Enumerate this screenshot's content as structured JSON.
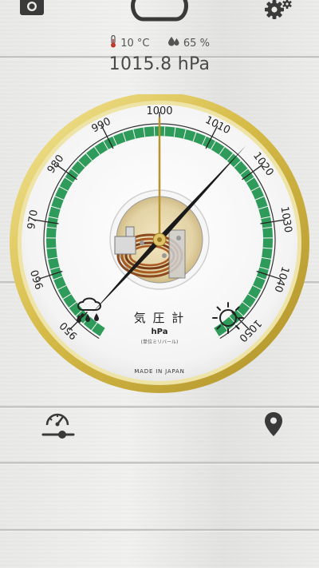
{
  "weather": {
    "temperature": "10 °C",
    "humidity": "65 %",
    "pressure_reading": "1015.8 hPa"
  },
  "gauge": {
    "scale": [
      950,
      960,
      970,
      980,
      990,
      1000,
      1010,
      1020,
      1030,
      1040,
      1050
    ],
    "scale_labels": [
      "950",
      "960",
      "970",
      "980",
      "990",
      "1000",
      "1010",
      "1020",
      "1030",
      "1040",
      "1050"
    ],
    "min": 945,
    "max": 1055,
    "needle_value": 1015.8,
    "reference_value": 1000,
    "title": "気 圧 計",
    "unit": "hPa",
    "subtitle": "(単位ミリバール)",
    "maker": "MADE IN JAPAN",
    "colors": {
      "band": "#2e9b5a",
      "rim": "#d9c35a",
      "needle": "#1a1a1a",
      "reference_needle": "#b8952b"
    }
  },
  "icons": {
    "camera": "camera-icon",
    "weather": "cloud-icon",
    "settings": "gear-icon",
    "rain": "rain-icon",
    "sun": "sun-icon",
    "gauge_settings": "gauge-slider-icon",
    "location": "location-pin-icon"
  }
}
